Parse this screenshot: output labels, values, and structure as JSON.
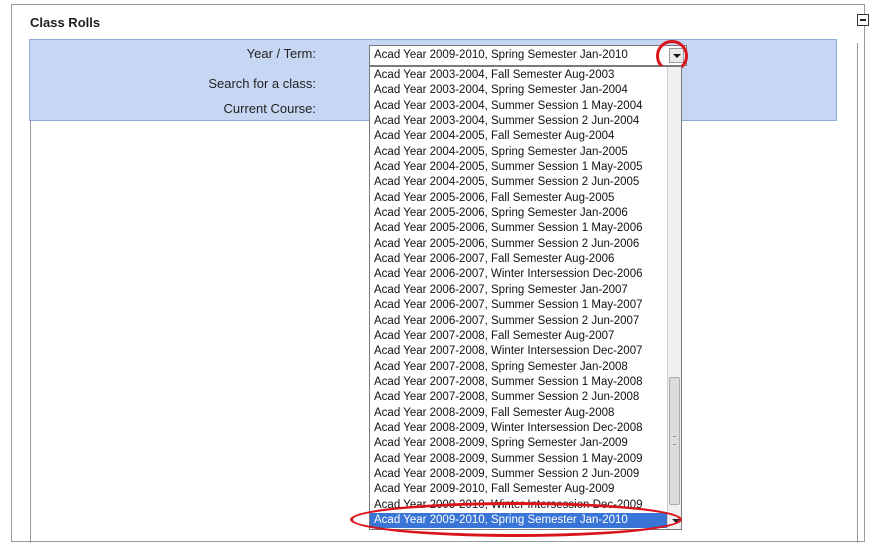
{
  "panel": {
    "title": "Class Rolls"
  },
  "form": {
    "year_term_label": "Year / Term:",
    "search_label": "Search for a class:",
    "current_course_label": "Current Course:"
  },
  "select": {
    "value": "Acad Year 2009-2010, Spring Semester Jan-2010",
    "options": [
      "Acad Year 2003-2004, Fall Semester Aug-2003",
      "Acad Year 2003-2004, Spring Semester Jan-2004",
      "Acad Year 2003-2004, Summer Session 1 May-2004",
      "Acad Year 2003-2004, Summer Session 2 Jun-2004",
      "Acad Year 2004-2005, Fall Semester Aug-2004",
      "Acad Year 2004-2005, Spring Semester Jan-2005",
      "Acad Year 2004-2005, Summer Session 1 May-2005",
      "Acad Year 2004-2005, Summer Session 2 Jun-2005",
      "Acad Year 2005-2006, Fall Semester Aug-2005",
      "Acad Year 2005-2006, Spring Semester Jan-2006",
      "Acad Year 2005-2006, Summer Session 1 May-2006",
      "Acad Year 2005-2006, Summer Session 2 Jun-2006",
      "Acad Year 2006-2007, Fall Semester Aug-2006",
      "Acad Year 2006-2007, Winter Intersession Dec-2006",
      "Acad Year 2006-2007, Spring Semester Jan-2007",
      "Acad Year 2006-2007, Summer Session 1 May-2007",
      "Acad Year 2006-2007, Summer Session 2 Jun-2007",
      "Acad Year 2007-2008, Fall Semester Aug-2007",
      "Acad Year 2007-2008, Winter Intersession Dec-2007",
      "Acad Year 2007-2008, Spring Semester Jan-2008",
      "Acad Year 2007-2008, Summer Session 1 May-2008",
      "Acad Year 2007-2008, Summer Session 2 Jun-2008",
      "Acad Year 2008-2009, Fall Semester Aug-2008",
      "Acad Year 2008-2009, Winter Intersession Dec-2008",
      "Acad Year 2008-2009, Spring Semester Jan-2009",
      "Acad Year 2008-2009, Summer Session 1 May-2009",
      "Acad Year 2008-2009, Summer Session 2 Jun-2009",
      "Acad Year 2009-2010, Fall Semester Aug-2009",
      "Acad Year 2009-2010, Winter Intersession Dec-2009",
      "Acad Year 2009-2010, Spring Semester Jan-2010"
    ],
    "selected_index": 29
  },
  "icons": {
    "collapse": "minus-box-icon",
    "dropdown": "chevron-down-icon"
  },
  "colors": {
    "form_bar": "#c6d6f3",
    "selected_option": "#3875d7",
    "annotation": "#d9141b"
  }
}
